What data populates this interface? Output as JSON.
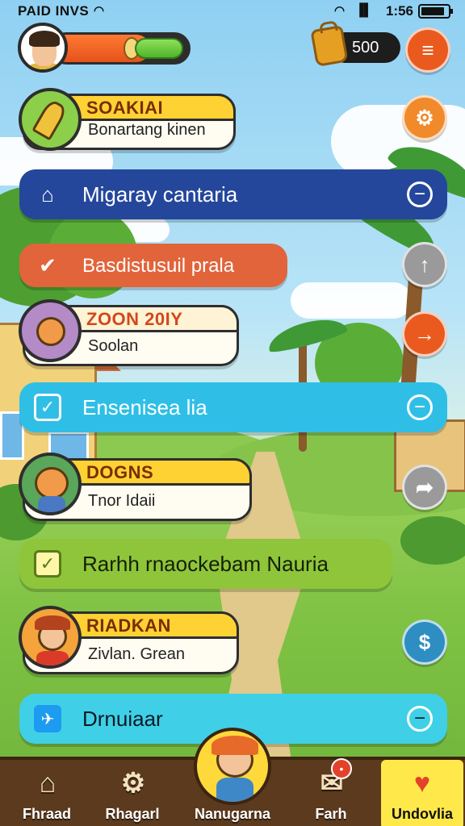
{
  "status_bar": {
    "left_text": "PAID",
    "left_text2": "INVS",
    "time": "1:56"
  },
  "hud": {
    "coins": "500",
    "xp_level": 0.72
  },
  "quests": [
    {
      "kind": "card",
      "title": "SOAKIAI",
      "subtitle": "Bonartang kinen",
      "badge_icon": "pen-icon"
    },
    {
      "kind": "bar",
      "label": "Migaray cantaria",
      "color": "#24479c",
      "left_icon": "house-icon",
      "right_icon": "minus-circle-icon"
    },
    {
      "kind": "bar",
      "label": "Basdistusuil prala",
      "color": "#e2643a",
      "left_icon": "check-icon"
    },
    {
      "kind": "card",
      "title": "ZOON 20IY",
      "subtitle": "Soolan",
      "badge_icon": "fox-icon"
    },
    {
      "kind": "bar",
      "label": "Ensenisea lia",
      "color": "#2fbfe6",
      "left_icon": "checkbox-icon",
      "right_icon": "minus-circle-icon"
    },
    {
      "kind": "card",
      "title": "DOGNS",
      "subtitle": "Tnor Idaii",
      "badge_icon": "fox-character-icon"
    },
    {
      "kind": "bar",
      "label": "Rarhh rnaockebam Nauria",
      "color": "#8fc53a",
      "left_icon": "checkbox-icon"
    },
    {
      "kind": "card",
      "title": "RIADKAN",
      "subtitle": "Zivlan. Grean",
      "badge_icon": "farmer-character-icon"
    },
    {
      "kind": "bar",
      "label": "Drnuiaar",
      "color": "#3fd0e8",
      "left_icon": "twitter-bird-icon",
      "right_icon": "minus-circle-icon"
    }
  ],
  "side_buttons": [
    "gear-icon",
    "arrow-up-icon",
    "arrow-right-icon",
    "share-arrow-icon",
    "dollar-icon"
  ],
  "nav": [
    {
      "label": "Fhraad",
      "icon": "home-icon"
    },
    {
      "label": "Rhagarl",
      "icon": "settings-gear-icon"
    },
    {
      "label": "Nanugarna",
      "icon": "character-icon"
    },
    {
      "label": "Farh",
      "icon": "mail-icon"
    },
    {
      "label": "Undovlia",
      "icon": "heart-bubble-icon",
      "active": true
    }
  ]
}
